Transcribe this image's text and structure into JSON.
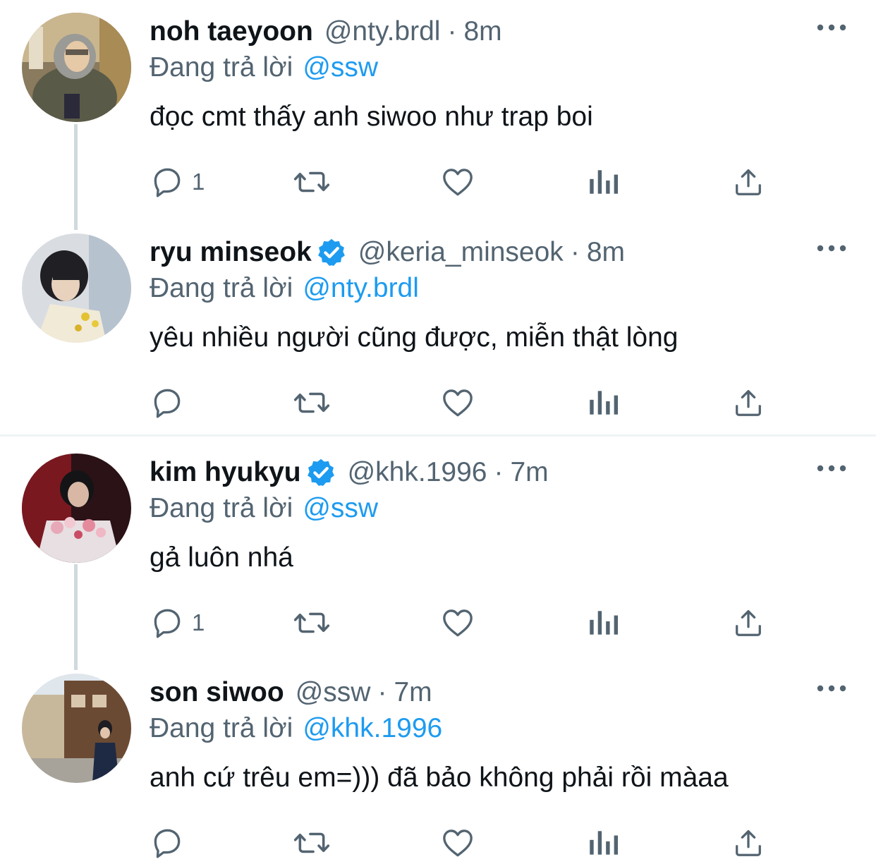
{
  "colors": {
    "accent": "#1d9bf0",
    "secondary_text": "#536471",
    "primary_text": "#0f1419",
    "thread_line": "#cfd9de"
  },
  "tweets": [
    {
      "name": "noh taeyoon",
      "handle": "@nty.brdl",
      "dot": "·",
      "time": "8m",
      "verified": false,
      "replying_label": "Đang trả lời",
      "replying_to": "@ssw",
      "text": "đọc cmt thấy anh siwoo như trap boi",
      "reply_count": "1"
    },
    {
      "name": "ryu minseok",
      "handle": "@keria_minseok",
      "dot": "·",
      "time": "8m",
      "verified": true,
      "replying_label": "Đang trả lời",
      "replying_to": "@nty.brdl",
      "text": "yêu nhiều người cũng được, miễn thật lòng",
      "reply_count": ""
    },
    {
      "name": "kim hyukyu",
      "handle": "@khk.1996",
      "dot": "·",
      "time": "7m",
      "verified": true,
      "replying_label": "Đang trả lời",
      "replying_to": "@ssw",
      "text": "gả luôn nhá",
      "reply_count": "1"
    },
    {
      "name": "son siwoo",
      "handle": "@ssw",
      "dot": "·",
      "time": "7m",
      "verified": false,
      "replying_label": "Đang trả lời",
      "replying_to": "@khk.1996",
      "text": "anh cứ trêu em=))) đã bảo không phải rồi màaa",
      "reply_count": ""
    }
  ]
}
